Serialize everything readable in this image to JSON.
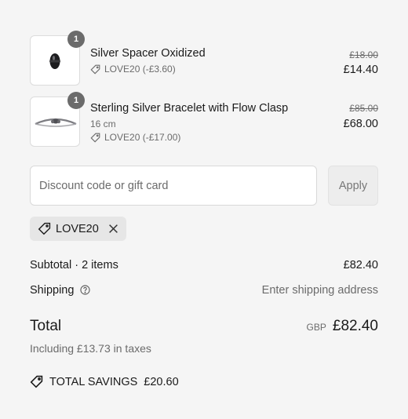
{
  "items": [
    {
      "name": "Silver Spacer Oxidized",
      "quantity": "1",
      "variant": "",
      "discount": "LOVE20 (-£3.60)",
      "original_price": "£18.00",
      "price": "£14.40",
      "image_icon": "black-bead-spacer"
    },
    {
      "name": "Sterling Silver Bracelet with Flow Clasp",
      "quantity": "1",
      "variant": "16 cm",
      "discount": "LOVE20 (-£17.00)",
      "original_price": "£85.00",
      "price": "£68.00",
      "image_icon": "silver-bracelet"
    }
  ],
  "discount_form": {
    "placeholder": "Discount code or gift card",
    "value": "",
    "apply_label": "Apply"
  },
  "applied_code": {
    "code": "LOVE20",
    "icon": "tag-icon",
    "remove_icon": "close-icon"
  },
  "summary": {
    "subtotal_label": "Subtotal · 2 items",
    "subtotal_value": "£82.40",
    "shipping_label": "Shipping",
    "shipping_value": "Enter shipping address",
    "total_label": "Total",
    "currency": "GBP",
    "total_value": "£82.40",
    "tax_note": "Including £13.73 in taxes",
    "savings_label": "TOTAL SAVINGS",
    "savings_value": "£20.60"
  },
  "colors": {
    "background": "#f5f5f5",
    "text": "#1a1a1a",
    "muted": "#6b6b6b",
    "badge": "#6b6b6b"
  }
}
